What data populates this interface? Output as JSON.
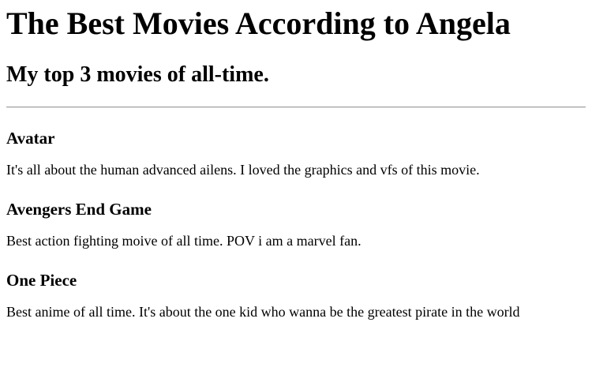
{
  "page": {
    "title": "The Best Movies According to Angela",
    "subtitle": "My top 3 movies of all-time."
  },
  "movies": [
    {
      "title": "Avatar",
      "description": "It's all about the human advanced ailens. I loved the graphics and vfs of this movie."
    },
    {
      "title": "Avengers End Game",
      "description": "Best action fighting moive of all time. POV i am a marvel fan."
    },
    {
      "title": "One Piece",
      "description": "Best anime of all time. It's about the one kid who wanna be the greatest pirate in the world"
    }
  ]
}
